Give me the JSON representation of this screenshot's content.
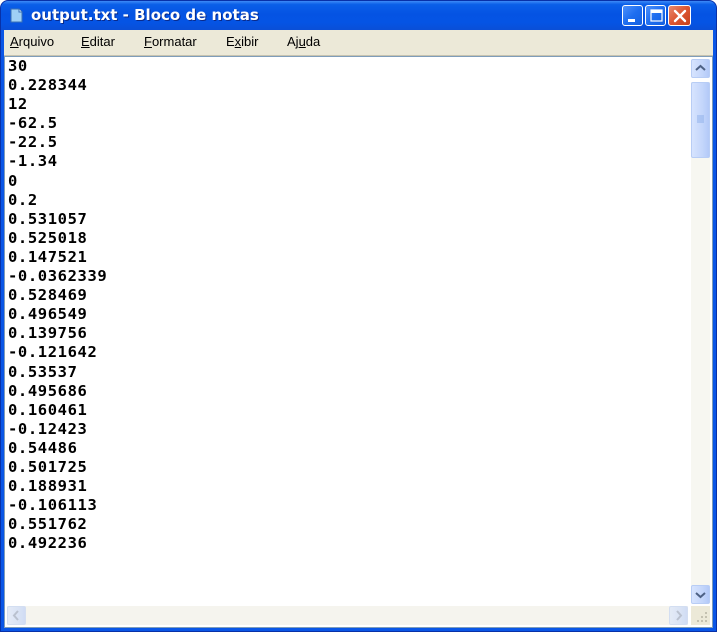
{
  "window": {
    "title": "output.txt - Bloco de notas",
    "icon": "notepad-icon"
  },
  "menu": [
    {
      "label": "Arquivo",
      "accel_index": 0
    },
    {
      "label": "Editar",
      "accel_index": 0
    },
    {
      "label": "Formatar",
      "accel_index": 0
    },
    {
      "label": "Exibir",
      "accel_index": 1
    },
    {
      "label": "Ajuda",
      "accel_index": 2
    }
  ],
  "content": {
    "lines": [
      "30",
      "0.228344",
      "12",
      "-62.5",
      "-22.5",
      "-1.34",
      "0",
      "0.2",
      "0.531057",
      "0.525018",
      "0.147521",
      "-0.0362339",
      "0.528469",
      "0.496549",
      "0.139756",
      "-0.121642",
      "0.53537",
      "0.495686",
      "0.160461",
      "-0.12423",
      "0.54486",
      "0.501725",
      "0.188931",
      "-0.106113",
      "0.551762",
      "0.492236"
    ]
  },
  "colors": {
    "titlebar": "#0554e4",
    "menubar": "#ece9d8",
    "close_button": "#dc5632"
  }
}
